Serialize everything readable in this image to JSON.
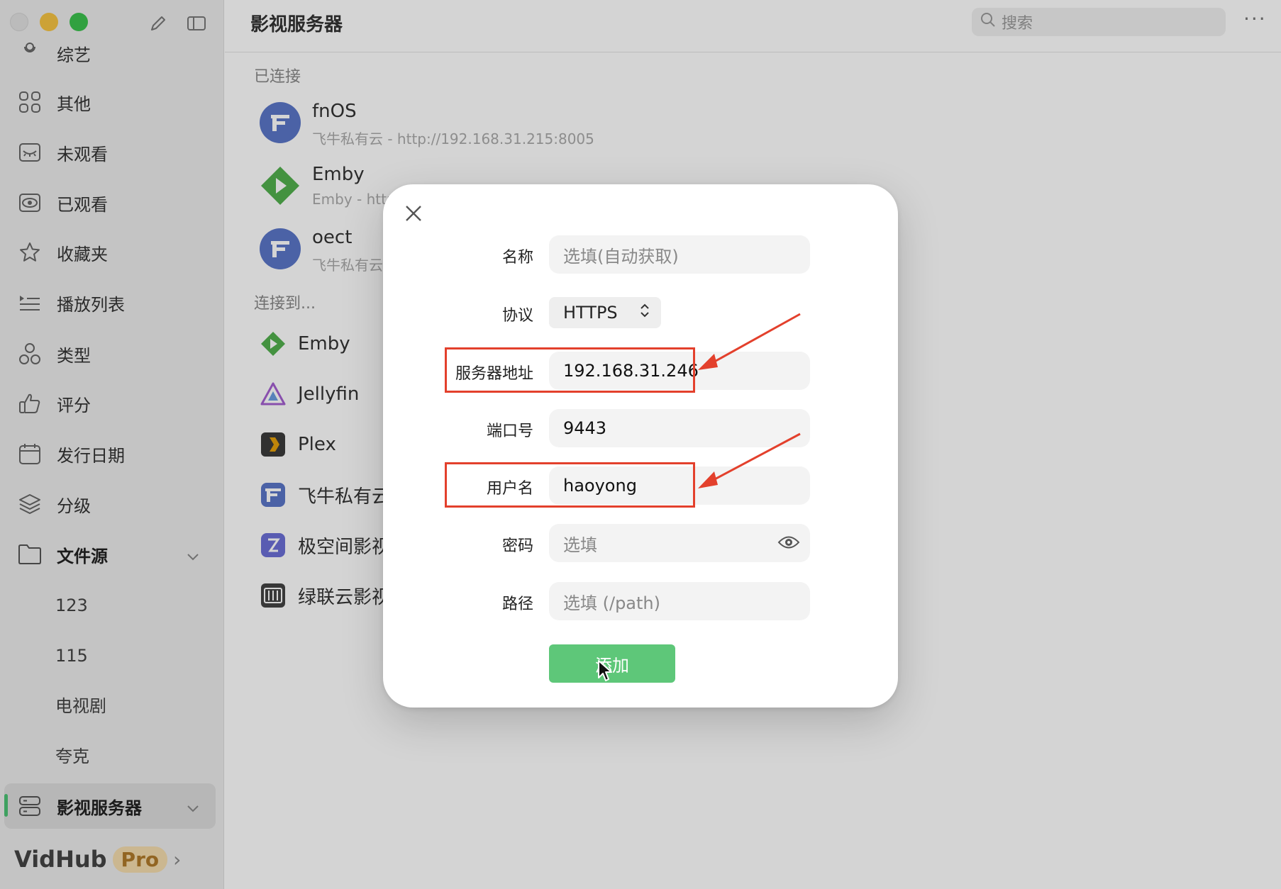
{
  "app": {
    "name": "VidHub",
    "badge": "Pro"
  },
  "sidebar": {
    "items": [
      {
        "label": "综艺",
        "icon": "microphone-icon"
      },
      {
        "label": "其他",
        "icon": "grid-icon"
      },
      {
        "label": "未观看",
        "icon": "eye-closed-icon"
      },
      {
        "label": "已观看",
        "icon": "eye-open-icon"
      },
      {
        "label": "收藏夹",
        "icon": "star-icon"
      },
      {
        "label": "播放列表",
        "icon": "playlist-icon"
      },
      {
        "label": "类型",
        "icon": "shapes-icon"
      },
      {
        "label": "评分",
        "icon": "thumbs-up-icon"
      },
      {
        "label": "发行日期",
        "icon": "calendar-icon"
      },
      {
        "label": "分级",
        "icon": "layers-icon"
      }
    ],
    "file_source": {
      "label": "文件源",
      "children": [
        "123",
        "115",
        "电视剧",
        "夸克"
      ]
    },
    "media_server": {
      "label": "影视服务器"
    }
  },
  "header": {
    "title": "影视服务器",
    "search_placeholder": "搜索",
    "more": "···"
  },
  "connected": {
    "label": "已连接",
    "servers": [
      {
        "name": "fnOS",
        "detail": "飞牛私有云 - http://192.168.31.215:8005"
      },
      {
        "name": "Emby",
        "detail": "Emby - http"
      },
      {
        "name": "oect",
        "detail": "飞牛私有云"
      }
    ]
  },
  "connect_to": {
    "label": "连接到...",
    "options": [
      "Emby",
      "Jellyfin",
      "Plex",
      "飞牛私有云",
      "极空间影视",
      "绿联云影视"
    ]
  },
  "dialog": {
    "fields": {
      "name": {
        "label": "名称",
        "placeholder": "选填(自动获取)"
      },
      "protocol": {
        "label": "协议",
        "value": "HTTPS"
      },
      "address": {
        "label": "服务器地址",
        "value": "192.168.31.246"
      },
      "port": {
        "label": "端口号",
        "value": "9443"
      },
      "username": {
        "label": "用户名",
        "value": "haoyong"
      },
      "password": {
        "label": "密码",
        "placeholder": "选填"
      },
      "path": {
        "label": "路径",
        "placeholder": "选填 (/path)"
      }
    },
    "submit": "添加"
  },
  "colors": {
    "accent": "#5ec779",
    "annotation": "#e3402c"
  }
}
